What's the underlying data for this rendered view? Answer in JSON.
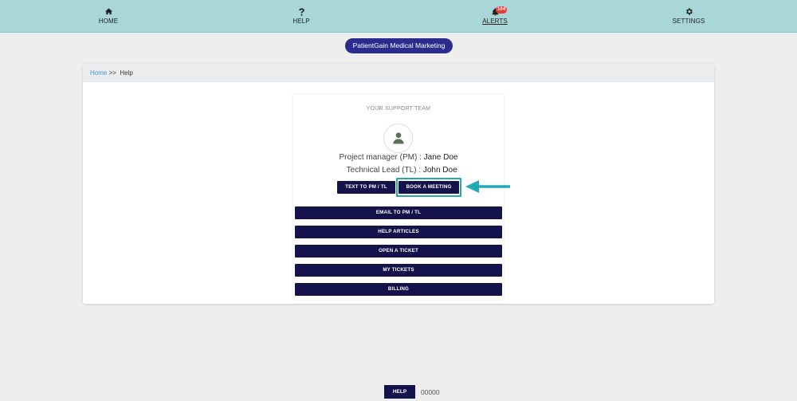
{
  "nav": {
    "home_label": "HOME",
    "help_label": "HELP",
    "alerts_label": "ALERTS",
    "alerts_badge": "104",
    "settings_label": "SETTINGS"
  },
  "company": {
    "name": "PatientGain Medical Marketing"
  },
  "breadcrumb": {
    "home": "Home",
    "separator": ">>",
    "current": "Help"
  },
  "support": {
    "title": "YOUR SUPPORT TEAM",
    "pm_label": "Project manager (PM) :",
    "pm_name": "Jane Doe",
    "tl_label": "Technical Lead (TL) :",
    "tl_name": "John Doe",
    "text_button": "TEXT TO PM / TL",
    "book_button": "BOOK A MEETING",
    "email_button": "EMAIL TO PM / TL",
    "articles_button": "HELP ARTICLES",
    "ticket_button": "OPEN A TICKET",
    "my_tickets_button": "MY TICKETS",
    "billing_button": "BILLING"
  },
  "footer": {
    "help_button": "HELP",
    "number": "00000"
  },
  "colors": {
    "nav_bg": "#a9d6d6",
    "pill_bg": "#2b2d8e",
    "button_bg": "#14124a",
    "highlight": "#22a9b5",
    "badge": "#e53935"
  }
}
